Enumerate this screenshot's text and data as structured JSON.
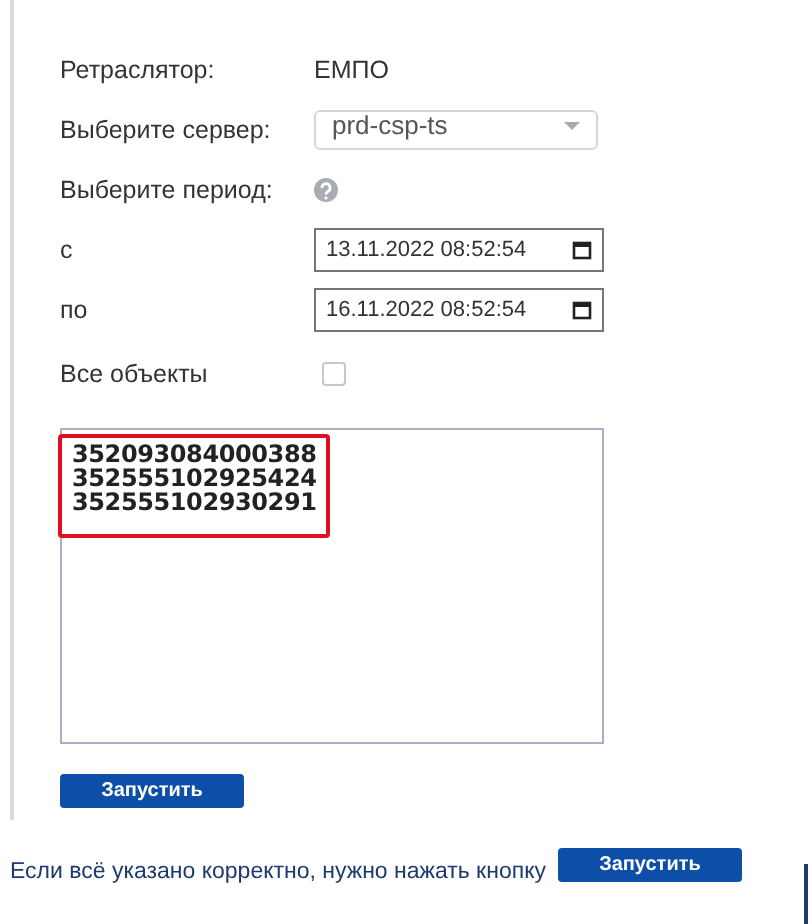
{
  "form": {
    "fields": [
      {
        "kind": "text",
        "label": "Ретраслятор:",
        "value": "ЕМПО"
      },
      {
        "kind": "select",
        "label": "Выберите сервер:",
        "value": "prd-csp-ts"
      },
      {
        "kind": "help",
        "label": "Выберите период:"
      },
      {
        "kind": "datetime",
        "label": "с",
        "value": "13.11.2022 08:52:54"
      },
      {
        "kind": "datetime",
        "label": "по",
        "value": "16.11.2022 08:52:54"
      },
      {
        "kind": "checkbox",
        "label": "Все объекты",
        "checked": false
      }
    ],
    "ids_text": [
      "352093084000388",
      "352555102925424",
      "352555102930291"
    ],
    "run_button": "Запустить"
  },
  "instruction": {
    "text": "Если всё указано корректно, нужно нажать кнопку",
    "button": "Запустить"
  }
}
